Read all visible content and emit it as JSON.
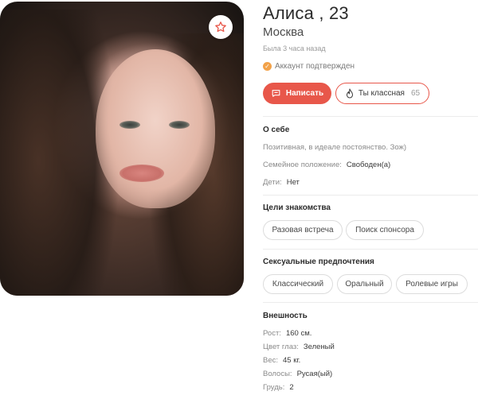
{
  "profile": {
    "name_age": "Алиса , 23",
    "city": "Москва",
    "last_seen": "Была 3 часа назад",
    "verified": "Аккаунт подтвержден"
  },
  "actions": {
    "write_label": "Написать",
    "like_label": "Ты классная",
    "like_count": "65"
  },
  "about": {
    "title": "О себе",
    "description": "Позитивная, в идеале постоянство. Зож)",
    "marital_label": "Семейное положение:",
    "marital_value": "Свободен(а)",
    "kids_label": "Дети:",
    "kids_value": "Нет"
  },
  "goals": {
    "title": "Цели знакомства",
    "items": [
      "Разовая встреча",
      "Поиск спонсора"
    ]
  },
  "preferences": {
    "title": "Сексуальные предпочтения",
    "items": [
      "Классический",
      "Оральный",
      "Ролевые игры"
    ]
  },
  "appearance": {
    "title": "Внешность",
    "height_label": "Рост:",
    "height_value": "160 см.",
    "eyes_label": "Цвет глаз:",
    "eyes_value": "Зеленый",
    "weight_label": "Вес:",
    "weight_value": "45 кг.",
    "hair_label": "Волосы:",
    "hair_value": "Русая(ый)",
    "breast_label": "Грудь:",
    "breast_value": "2"
  },
  "colors": {
    "accent": "#e8574a",
    "verified": "#f2a24a"
  },
  "icons": {
    "favorite": "star-outline-icon",
    "verified": "check-circle-icon",
    "write": "chat-bubble-icon",
    "like": "flame-icon"
  }
}
